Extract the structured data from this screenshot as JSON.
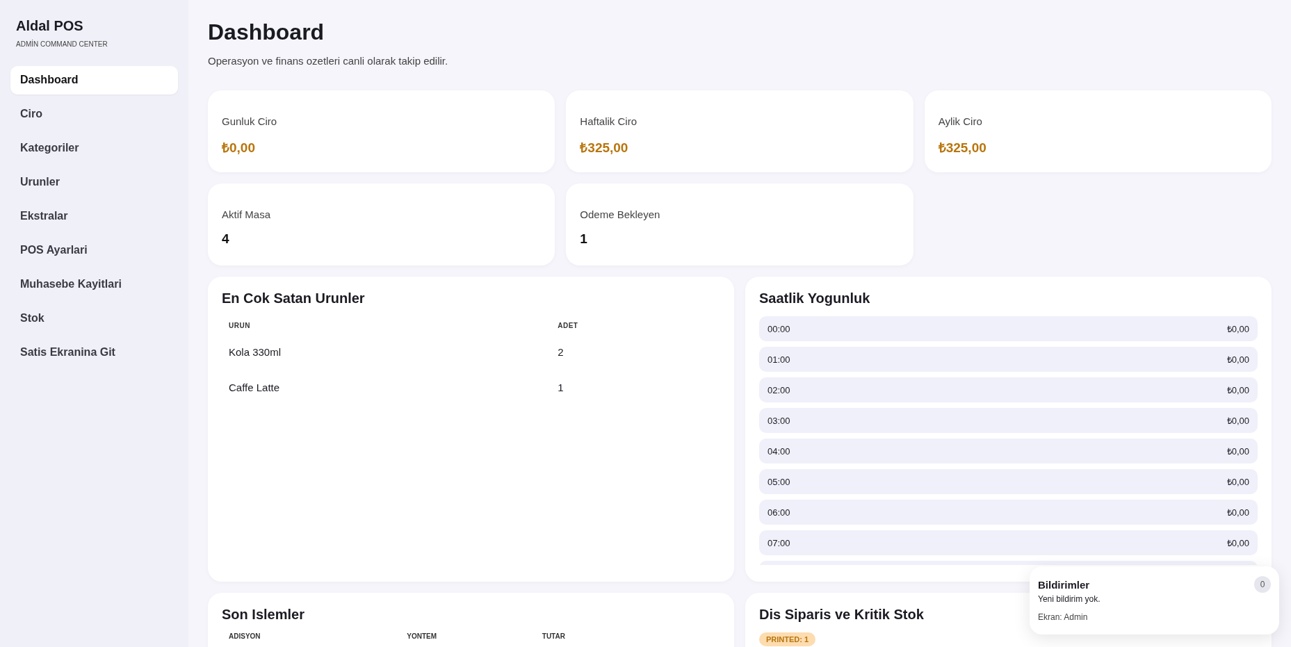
{
  "sidebar": {
    "brand": "Aldal POS",
    "subtitle": "ADMİN COMMAND CENTER",
    "items": [
      {
        "label": "Dashboard",
        "selected": true
      },
      {
        "label": "Ciro",
        "selected": false
      },
      {
        "label": "Kategoriler",
        "selected": false
      },
      {
        "label": "Urunler",
        "selected": false
      },
      {
        "label": "Ekstralar",
        "selected": false
      },
      {
        "label": "POS Ayarlari",
        "selected": false
      },
      {
        "label": "Muhasebe Kayitlari",
        "selected": false
      },
      {
        "label": "Stok",
        "selected": false
      },
      {
        "label": "Satis Ekranina Git",
        "selected": false
      }
    ]
  },
  "header": {
    "title": "Dashboard",
    "subtitle": "Operasyon ve finans ozetleri canli olarak takip edilir."
  },
  "stats": [
    {
      "label": "Gunluk Ciro",
      "value": "₺0,00",
      "kind": "money"
    },
    {
      "label": "Haftalik Ciro",
      "value": "₺325,00",
      "kind": "money"
    },
    {
      "label": "Aylik Ciro",
      "value": "₺325,00",
      "kind": "money"
    },
    {
      "label": "Aktif Masa",
      "value": "4",
      "kind": "count"
    },
    {
      "label": "Odeme Bekleyen",
      "value": "1",
      "kind": "count"
    }
  ],
  "top_products": {
    "title": "En Cok Satan Urunler",
    "columns": [
      "URUN",
      "ADET"
    ],
    "rows": [
      [
        "Kola 330ml",
        "2"
      ],
      [
        "Caffe Latte",
        "1"
      ]
    ]
  },
  "hourly": {
    "title": "Saatlik Yogunluk",
    "rows": [
      {
        "hour": "00:00",
        "amount": "₺0,00"
      },
      {
        "hour": "01:00",
        "amount": "₺0,00"
      },
      {
        "hour": "02:00",
        "amount": "₺0,00"
      },
      {
        "hour": "03:00",
        "amount": "₺0,00"
      },
      {
        "hour": "04:00",
        "amount": "₺0,00"
      },
      {
        "hour": "05:00",
        "amount": "₺0,00"
      },
      {
        "hour": "06:00",
        "amount": "₺0,00"
      },
      {
        "hour": "07:00",
        "amount": "₺0,00"
      }
    ]
  },
  "recent": {
    "title": "Son Islemler",
    "columns": [
      "ADISYON",
      "YONTEM",
      "TUTAR"
    ]
  },
  "external": {
    "title": "Dis Siparis ve Kritik Stok",
    "badges": [
      "PRINTED: 1"
    ]
  },
  "notifications": {
    "title": "Bildirimler",
    "count": "0",
    "message": "Yeni bildirim yok.",
    "screen": "Ekran: Admin"
  }
}
